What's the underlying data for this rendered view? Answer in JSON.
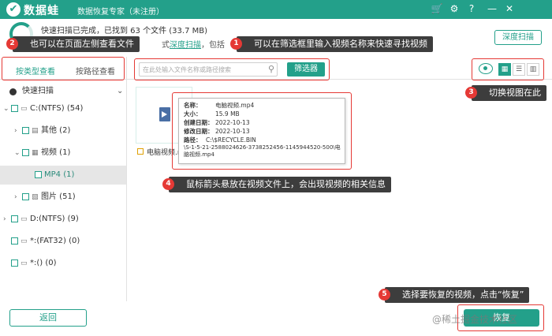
{
  "titlebar": {
    "logo_glyph": "✔",
    "app_name": "数据蛙",
    "subtitle": "数据恢复专家（未注册）",
    "icons": [
      "cart-icon",
      "settings-icon",
      "help-icon",
      "minimize-icon",
      "close-icon"
    ]
  },
  "scan": {
    "status": "快速扫描已完成，已找到 63 个文件 (33.7 MB)",
    "hint_prefix": "式",
    "hint_link": "深度扫描",
    "hint_suffix": "，包括",
    "deep_scan_button": "深度扫描"
  },
  "tabs": {
    "by_type": "按类型查看",
    "by_path": "按路径查看"
  },
  "search": {
    "placeholder": "在此处输入文件名称或路径搜索",
    "value": ""
  },
  "filter_button": "筛选器",
  "tree": {
    "root": "快速扫描",
    "items": [
      {
        "label": "C:(NTFS) (54)"
      },
      {
        "label": "其他 (2)"
      },
      {
        "label": "视频 (1)"
      },
      {
        "label": "MP4 (1)"
      },
      {
        "label": "图片 (51)"
      },
      {
        "label": "D:(NTFS) (9)"
      },
      {
        "label": "*:(FAT32) (0)"
      },
      {
        "label": "*:() (0)"
      }
    ]
  },
  "file": {
    "name": "电脑视频.m"
  },
  "tooltip": {
    "name_label": "名称：",
    "name_value": "电脑视频.mp4",
    "size_label": "大小：",
    "size_value": "15.9 MB",
    "created_label": "创建日期：",
    "created_value": "2022-10-13",
    "modified_label": "修改日期：",
    "modified_value": "2022-10-13",
    "path_label": "路径：",
    "path_line1": "C:\\$RECYCLE.BIN",
    "path_line2": "\\S-1-5-21-2588024626-3738252456-1145944520-500\\电",
    "path_line3": "脑视频.mp4"
  },
  "callouts": [
    {
      "num": "1",
      "text": "可以在筛选框里输入视频名称来快速寻找视频"
    },
    {
      "num": "2",
      "text": "也可以在页面左侧查看文件"
    },
    {
      "num": "3",
      "text": "切换视图在此"
    },
    {
      "num": "4",
      "text": "鼠标箭头悬放在视频文件上，会出现视频的相关信息"
    },
    {
      "num": "5",
      "text": "选择要恢复的视频，点击“恢复”"
    }
  ],
  "footer": {
    "back": "返回",
    "recover": "恢复"
  },
  "watermark": "@稀土掘金技术社区",
  "colors": {
    "brand": "#23a08a",
    "annotation": "#e53935",
    "callout_bg": "#3d3d3d"
  }
}
